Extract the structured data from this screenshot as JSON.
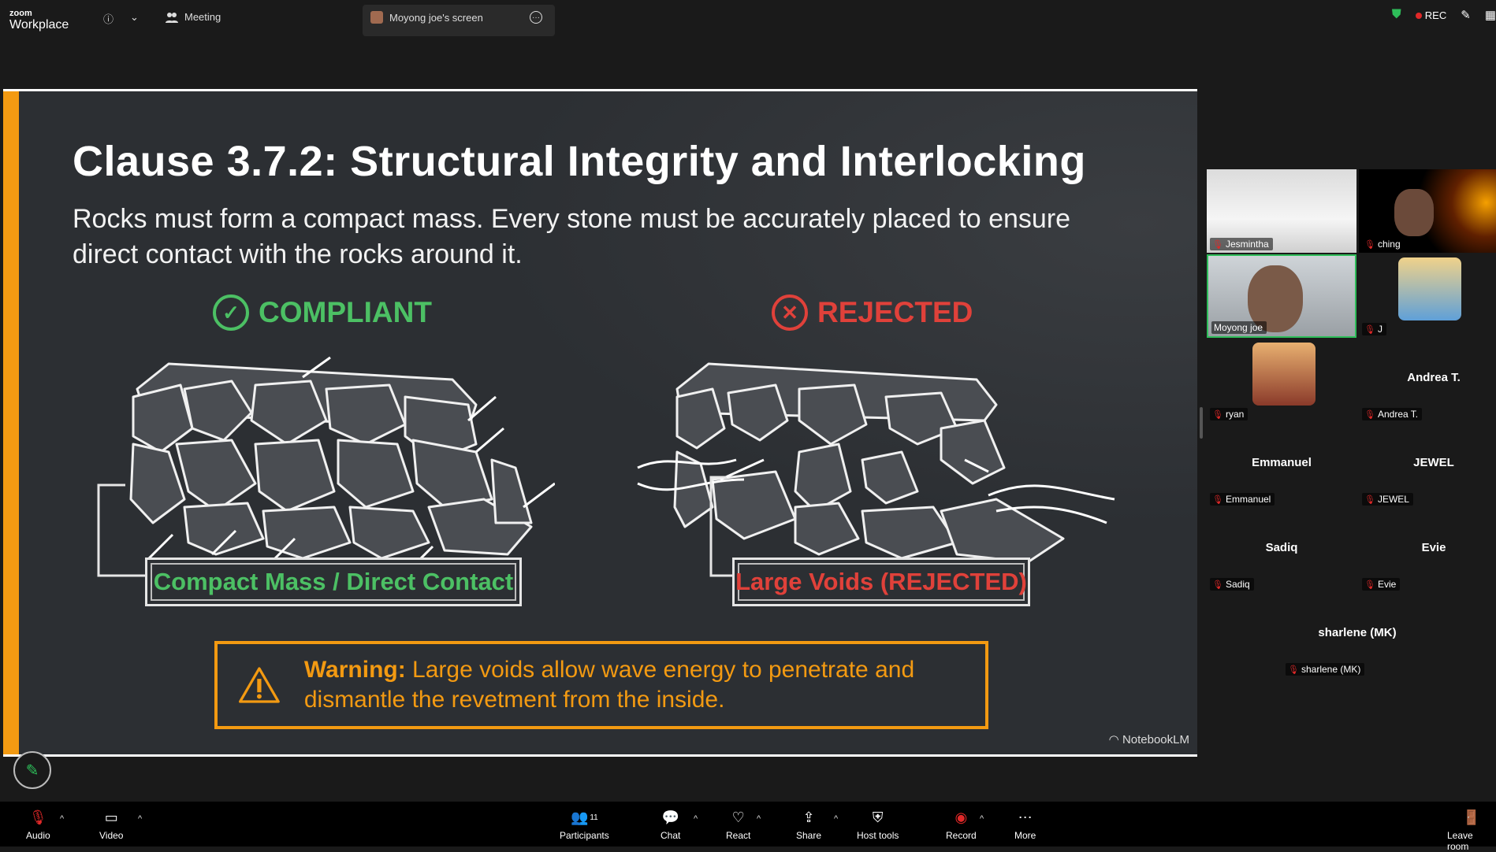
{
  "app": {
    "brand_small": "zoom",
    "brand_big": "Workplace"
  },
  "topbar": {
    "meeting_label": "Meeting",
    "shared_screen_label": "Moyong joe's screen",
    "rec_label": "REC"
  },
  "slide": {
    "title": "Clause 3.7.2: Structural Integrity and Interlocking",
    "subtitle": "Rocks must form a compact mass. Every stone must be accurately placed to ensure direct contact with the rocks around it.",
    "compliant_label": "COMPLIANT",
    "rejected_label": "REJECTED",
    "compliant_box": "Compact Mass / Direct Contact",
    "rejected_box": "Large Voids (REJECTED)",
    "warning_bold": "Warning:",
    "warning_text": " Large voids allow wave energy to penetrate and dismantle the revetment from the inside.",
    "watermark": "NotebookLM",
    "colors": {
      "accent": "#f39a12",
      "ok": "#4cc064",
      "bad": "#e0413a"
    }
  },
  "participants_gallery": [
    {
      "name": "Jesmintha",
      "video": true
    },
    {
      "name": "ching",
      "video": true
    },
    {
      "name": "Moyong joe",
      "video": true,
      "active_speaker": true
    },
    {
      "name": "J",
      "video": false
    },
    {
      "name": "ryan",
      "video": false
    },
    {
      "name": "Andrea T.",
      "display": "Andrea T."
    },
    {
      "name": "Emmanuel",
      "display": "Emmanuel"
    },
    {
      "name": "JEWEL",
      "display": "JEWEL"
    },
    {
      "name": "Sadiq",
      "display": "Sadiq"
    },
    {
      "name": "Evie",
      "display": "Evie"
    },
    {
      "name": "sharlene (MK)",
      "display": "sharlene (MK)"
    }
  ],
  "bottombar": {
    "audio": "Audio",
    "video": "Video",
    "participants": "Participants",
    "participants_count": "11",
    "chat": "Chat",
    "react": "React",
    "share": "Share",
    "host_tools": "Host tools",
    "record": "Record",
    "more": "More",
    "leave": "Leave room"
  }
}
